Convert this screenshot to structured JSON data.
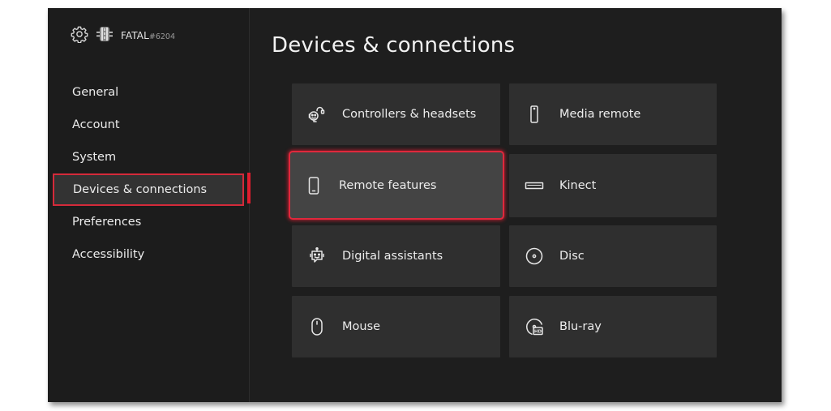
{
  "profile": {
    "gear_icon": "gear-icon",
    "avatar_icon": "gamerpic-avatar",
    "gamertag": "FATAL",
    "suffix": "#6204"
  },
  "sidebar": {
    "items": [
      {
        "label": "General",
        "active": false
      },
      {
        "label": "Account",
        "active": false
      },
      {
        "label": "System",
        "active": false
      },
      {
        "label": "Devices & connections",
        "active": true
      },
      {
        "label": "Preferences",
        "active": false
      },
      {
        "label": "Accessibility",
        "active": false
      }
    ]
  },
  "page": {
    "title": "Devices & connections"
  },
  "tiles": [
    {
      "label": "Controllers & headsets",
      "icon": "controller-headset-icon"
    },
    {
      "label": "Media remote",
      "icon": "media-remote-icon"
    },
    {
      "label": "Remote features",
      "icon": "phone-icon",
      "focused": true
    },
    {
      "label": "Kinect",
      "icon": "kinect-icon"
    },
    {
      "label": "Digital assistants",
      "icon": "robot-assistant-icon"
    },
    {
      "label": "Disc",
      "icon": "disc-icon"
    },
    {
      "label": "Mouse",
      "icon": "mouse-icon"
    },
    {
      "label": "Blu-ray",
      "icon": "bluray-hd-icon"
    }
  ],
  "colors": {
    "highlight": "#e0283c",
    "background": "#1e1e1e",
    "tile": "#2f2f2f",
    "tile_focused": "#444444"
  }
}
